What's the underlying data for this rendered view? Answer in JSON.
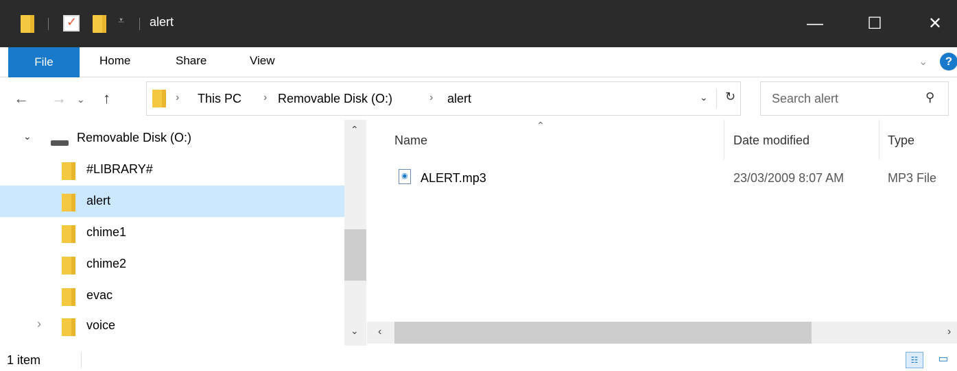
{
  "window": {
    "title": "alert"
  },
  "title_buttons": {
    "minimize": "—",
    "maximize": "☐",
    "close": "✕"
  },
  "ribbon": {
    "tabs": [
      "File",
      "Home",
      "Share",
      "View"
    ]
  },
  "address": {
    "breadcrumbs": [
      "This PC",
      "Removable Disk (O:)",
      "alert"
    ],
    "search_placeholder": "Search alert"
  },
  "nav": {
    "items": [
      {
        "label": "Removable Disk (O:)",
        "type": "drive",
        "expanded": true
      },
      {
        "label": "#LIBRARY#",
        "type": "folder"
      },
      {
        "label": "alert",
        "type": "folder",
        "selected": true
      },
      {
        "label": "chime1",
        "type": "folder"
      },
      {
        "label": "chime2",
        "type": "folder"
      },
      {
        "label": "evac",
        "type": "folder"
      },
      {
        "label": "voice",
        "type": "folder",
        "expandable": true
      }
    ]
  },
  "columns": [
    "Name",
    "Date modified",
    "Type"
  ],
  "files": [
    {
      "name": "ALERT.mp3",
      "date": "23/03/2009 8:07 AM",
      "type": "MP3 File"
    }
  ],
  "status": {
    "item_count": "1 item"
  },
  "colors": {
    "accent": "#1979ca",
    "titlebar": "#2b2b2b",
    "selection": "#cce8ff",
    "folder": "#f5c842"
  }
}
